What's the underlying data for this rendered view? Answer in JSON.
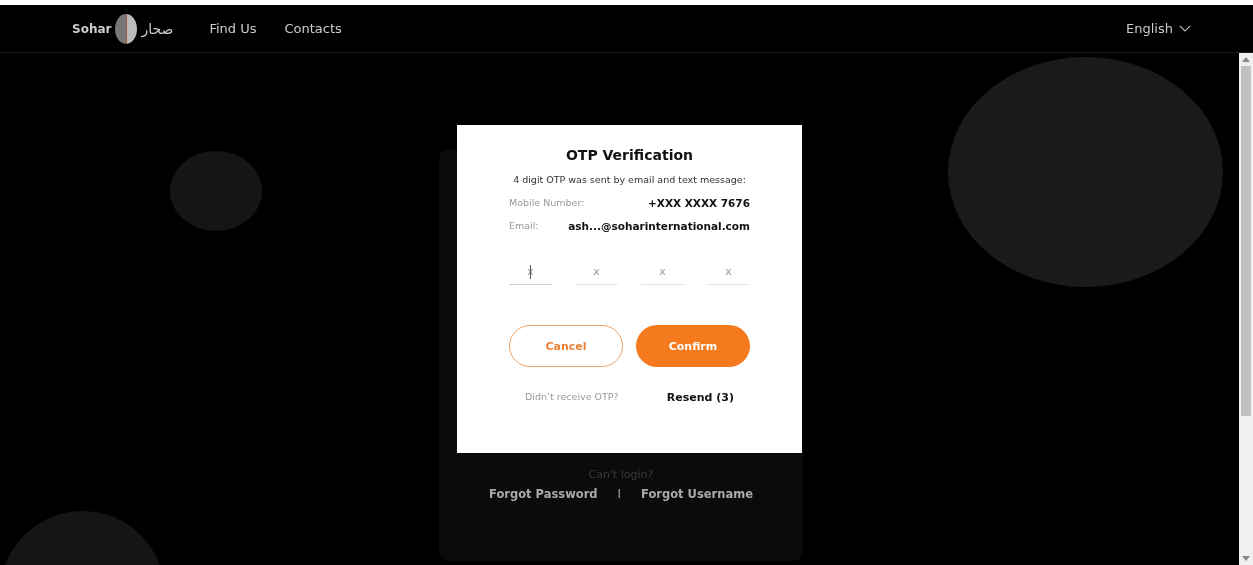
{
  "nav": {
    "logo_latin": "Sohar",
    "logo_arabic": "صحار",
    "links": [
      {
        "label": "Find Us"
      },
      {
        "label": "Contacts"
      }
    ],
    "language": "English"
  },
  "login_card": {
    "prompt": "Can't login?",
    "links": [
      {
        "label": "Forgot Password"
      },
      {
        "label": "Forgot Username"
      }
    ],
    "separator": "I"
  },
  "dialog": {
    "title": "OTP Verification",
    "message": "4 digit OTP was sent by email and text message:",
    "details": [
      {
        "label": "Mobile Number:",
        "value": "+XXX XXXX 7676"
      },
      {
        "label": "Email:",
        "value": "ash...@soharinternational.com"
      }
    ],
    "otp_fields": [
      {
        "placeholder": "x",
        "focused": true
      },
      {
        "placeholder": "x",
        "focused": false
      },
      {
        "placeholder": "x",
        "focused": false
      },
      {
        "placeholder": "x",
        "focused": false
      }
    ],
    "buttons": [
      {
        "label": "Cancel",
        "kind": "outline"
      },
      {
        "label": "Confirm",
        "kind": "primary"
      }
    ],
    "resend_prompt": "Didn’t receive OTP?",
    "resend_link": "Resend (3)"
  }
}
